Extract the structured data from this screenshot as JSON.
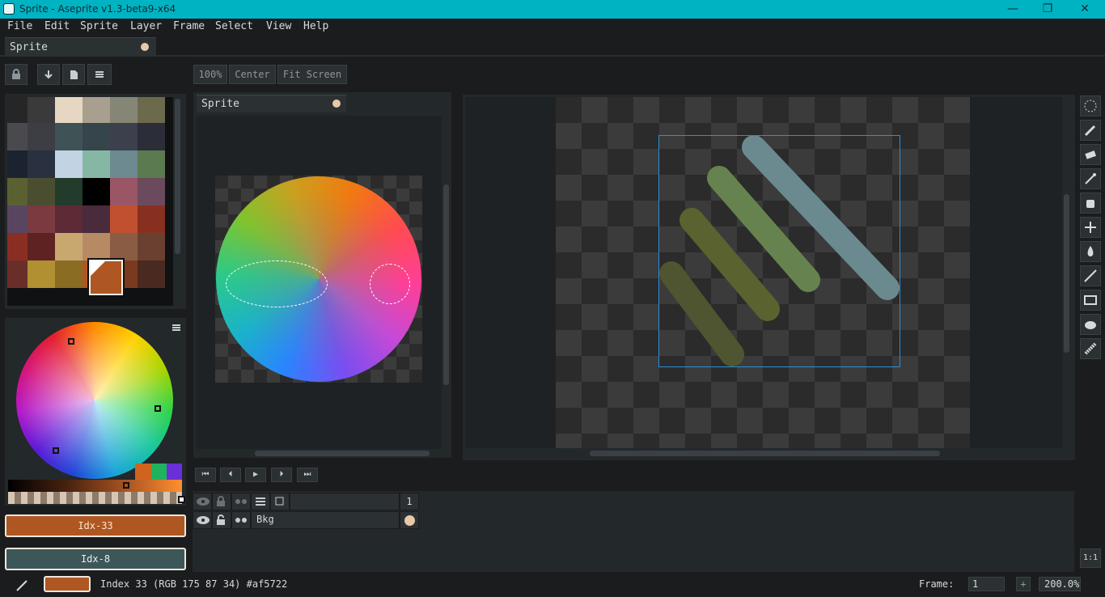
{
  "window": {
    "title": "Sprite - Aseprite v1.3-beta9-x64",
    "controls": [
      "—",
      "❐",
      "✕"
    ]
  },
  "menu": [
    "File",
    "Edit",
    "Sprite",
    "Layer",
    "Frame",
    "Select",
    "View",
    "Help"
  ],
  "tabs": {
    "main": "Sprite",
    "preview": "Sprite"
  },
  "view_buttons": {
    "zoom": "100%",
    "center": "Center",
    "fit": "Fit Screen"
  },
  "palette_colors": [
    "#262626",
    "#3a3a3a",
    "#e6d7c2",
    "#a89f8f",
    "#868676",
    "#6c6a4c",
    "#4a4a4e",
    "#3d3d44",
    "#3f5357",
    "#35454a",
    "#3c3f4c",
    "#2b2d38",
    "#1c2330",
    "#29303f",
    "#c2d4e3",
    "#86b7a4",
    "#6c8a8f",
    "#5c7a50",
    "#5a6030",
    "#4a4d30",
    "#233b2a",
    "#000000",
    "#9a5664",
    "#6a4a5c",
    "#5a4560",
    "#7a3a40",
    "#5d2a36",
    "#4a2b3c",
    "#c05030",
    "#883020",
    "#8b2e22",
    "#5e2222",
    "#c9a870",
    "#b88a64",
    "#8a5c44",
    "#6a4030",
    "#6a2e28",
    "#b09030",
    "#8a6d22",
    "#af5722",
    "#7a3a20",
    "#4a2a20"
  ],
  "color_buttons": {
    "fg": "Idx-33",
    "bg": "Idx-8",
    "fg_hex": "#af5722",
    "bg_hex": "#3d5759"
  },
  "timeline": {
    "frame_header": "1",
    "layer_name": "Bkg"
  },
  "status": {
    "text": "Index 33 (RGB 175 87 34) #af5722",
    "frame_label": "Frame:",
    "frame_value": "1",
    "plus": "+",
    "zoom": "200.0%"
  },
  "ratio_button": "1:1",
  "toolbar_icons": [
    "ellipse-marquee-icon",
    "pencil-icon",
    "eraser-icon",
    "eyedropper-icon",
    "hand-icon",
    "move-icon",
    "paint-bucket-icon",
    "line-icon",
    "rectangle-icon",
    "blur-icon",
    "jumble-icon"
  ]
}
